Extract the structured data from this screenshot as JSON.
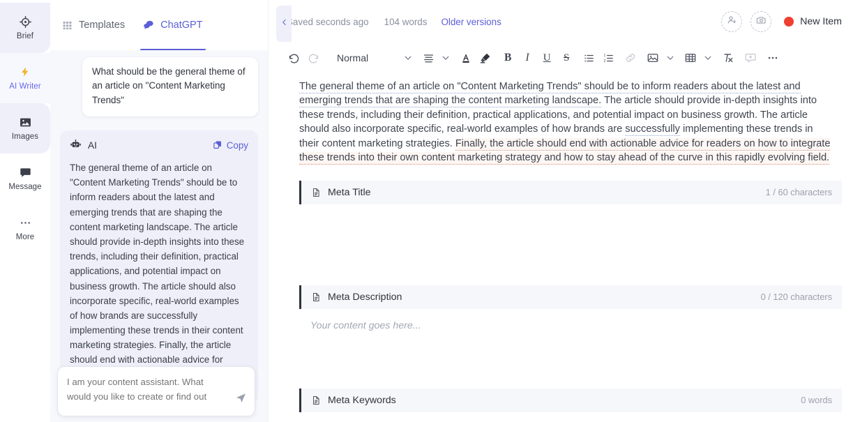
{
  "sidebar": {
    "items": [
      {
        "label": "Brief",
        "icon": "target-icon",
        "state": "shaded"
      },
      {
        "label": "AI Writer",
        "icon": "lightning-icon",
        "state": "active"
      },
      {
        "label": "Images",
        "icon": "image-icon",
        "state": "shaded"
      },
      {
        "label": "Message",
        "icon": "chat-bubble-icon",
        "state": "plain"
      },
      {
        "label": "More",
        "icon": "ellipsis-icon",
        "state": "plain"
      }
    ]
  },
  "chat": {
    "tabs": [
      {
        "label": "Templates",
        "icon": "grid-icon",
        "active": false
      },
      {
        "label": "ChatGPT",
        "icon": "chat-bubbles-icon",
        "active": true
      }
    ],
    "user_message": "What should be the general theme of an article on \"Content Marketing Trends\"",
    "ai_label": "AI",
    "copy_label": "Copy",
    "ai_message": "The general theme of an article on \"Content Marketing Trends\" should be to inform readers about the latest and emerging trends that are shaping the content marketing landscape. The article should provide in-depth insights into these trends, including their definition, practical applications, and potential impact on business growth. The article should also incorporate specific, real-world examples of how brands are successfully implementing these trends in their content marketing strategies. Finally, the article should end with actionable advice for readers on how to integrate these trends into",
    "input_placeholder": "I am your content assistant. What would you like to create or find out today?",
    "input_value": "",
    "send_icon": "send-icon",
    "collapse_icon": "chevron-left-icon"
  },
  "header": {
    "saved_status": "Saved seconds ago",
    "word_count": "104 words",
    "older_versions": "Older versions",
    "add_user_icon": "add-user-icon",
    "add_photo_icon": "add-photo-icon",
    "status_color": "#f03e2f",
    "new_item_label": "New Item"
  },
  "toolbar": {
    "undo": "undo-icon",
    "redo": "redo-icon",
    "style_label": "Normal",
    "items": [
      "align-icon",
      "text-color-icon",
      "highlighter-icon",
      "bold-icon",
      "italic-icon",
      "underline-icon",
      "strikethrough-icon",
      "bullet-list-icon",
      "numbered-list-icon",
      "link-icon",
      "image-icon",
      "table-icon",
      "clear-format-icon",
      "comment-icon",
      "more-icon"
    ]
  },
  "editor": {
    "paragraph_segments": [
      {
        "text": "The general theme of an article on \"Content Marketing Trends\" should be to inform readers about the latest and emerging trends that are shaping the content marketing landscape.",
        "mark": "blue"
      },
      {
        "text": " The article should provide in-depth insights into these trends, including their definition, practical applications, and potential impact on business growth. The article should also incorporate specific, real-world examples of how brands are ",
        "mark": "none"
      },
      {
        "text": "successfully",
        "mark": "blue"
      },
      {
        "text": " implementing these trends in their content marketing strategies. ",
        "mark": "none"
      },
      {
        "text": "Finally, the article should end with actionable advice for readers on how to integrate these trends into their own content marketing strategy and how to stay ahead of the curve in this rapidly evolving field.",
        "mark": "red"
      }
    ]
  },
  "meta_sections": [
    {
      "title": "Meta Title",
      "counter": "1 / 60 characters",
      "value": "",
      "icon": "document-icon"
    },
    {
      "title": "Meta Description",
      "counter": "0 / 120 characters",
      "value": "Your content goes here...",
      "icon": "document-icon"
    },
    {
      "title": "Meta Keywords",
      "counter": "0 words",
      "value": "",
      "icon": "document-icon"
    }
  ],
  "colors": {
    "accent": "#5b5fd6",
    "rail_shade": "#eeeff9",
    "chat_bg": "#f7f8fc",
    "ai_bubble": "#eeeff9",
    "status_red": "#f03e2f",
    "grammar_blue": "#8aa6c8",
    "grammar_red": "#d98f7a"
  }
}
